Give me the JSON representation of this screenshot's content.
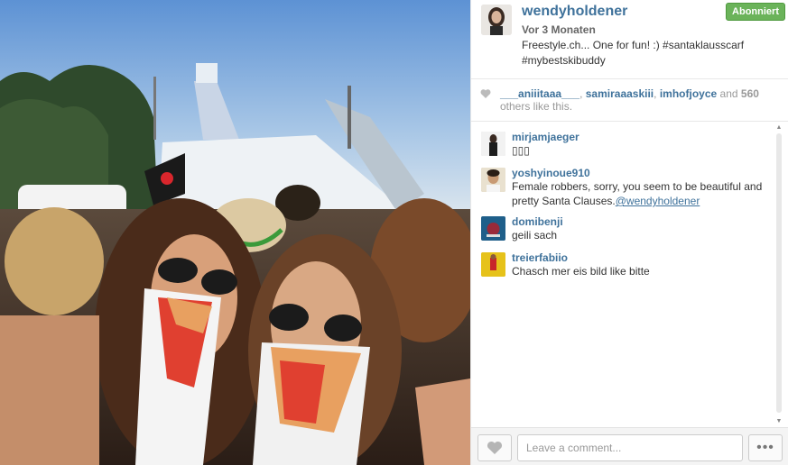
{
  "post": {
    "username": "wendyholdener",
    "time_ago": "Vor 3 Monaten",
    "caption": "Freestyle.ch... One for fun! :) #santaklausscarf #mybestskibuddy",
    "follow_label": "Abonniert"
  },
  "likes": {
    "users": [
      "___aniiitaaa___",
      "samiraaaskiii",
      "imhofjoyce"
    ],
    "separator": ", ",
    "and_text": " and ",
    "count": "560",
    "suffix": " others like this."
  },
  "comments": [
    {
      "user": "mirjamjaeger",
      "text": "▯▯▯",
      "mention": ""
    },
    {
      "user": "yoshyinoue910",
      "text": "Female robbers, sorry, you seem to be beautiful and pretty Santa Clauses.",
      "mention": "@wendyholdener"
    },
    {
      "user": "domibenji",
      "text": "geili sach",
      "mention": ""
    },
    {
      "user": "treierfabiio",
      "text": "Chasch mer eis bild like bitte",
      "mention": ""
    }
  ],
  "footer": {
    "comment_placeholder": "Leave a comment...",
    "more_label": "•••"
  },
  "icons": {
    "heart": "heart-icon",
    "more": "ellipsis-icon"
  },
  "colors": {
    "link": "#3f729b",
    "follow": "#6bb35a"
  }
}
